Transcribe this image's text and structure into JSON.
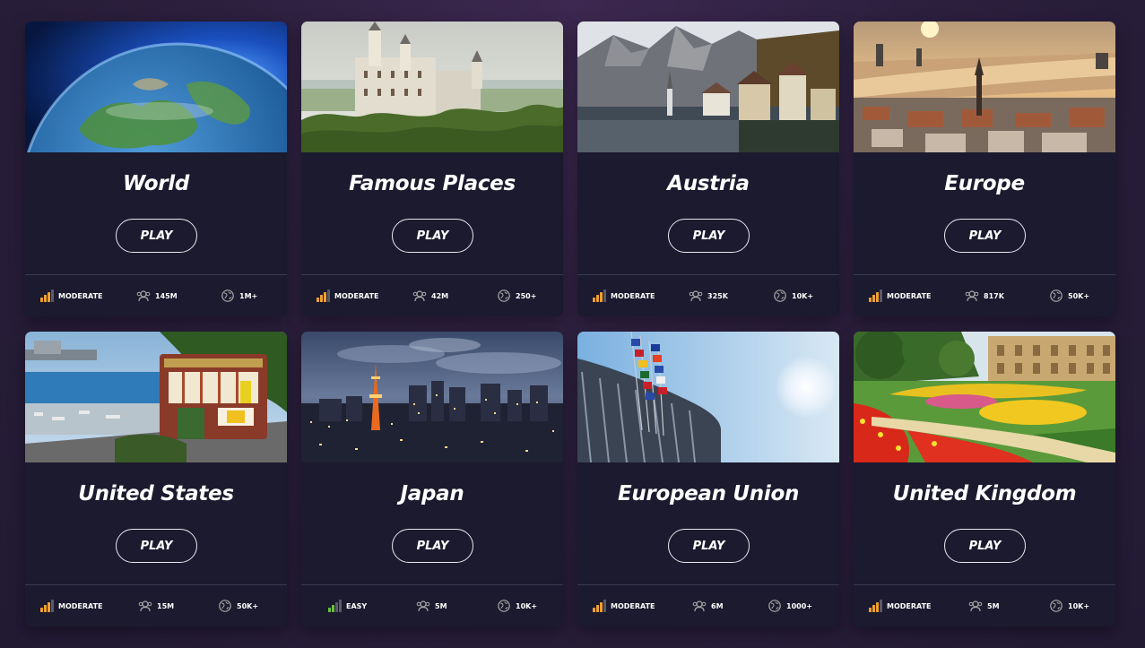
{
  "cards": [
    {
      "title": "World",
      "play_label": "PLAY",
      "difficulty": "MODERATE",
      "difficulty_level": 2,
      "players": "145M",
      "locations": "1M+",
      "image": "earth-from-space"
    },
    {
      "title": "Famous Places",
      "play_label": "PLAY",
      "difficulty": "MODERATE",
      "difficulty_level": 2,
      "players": "42M",
      "locations": "250+",
      "image": "neuschwanstein-castle"
    },
    {
      "title": "Austria",
      "play_label": "PLAY",
      "difficulty": "MODERATE",
      "difficulty_level": 2,
      "players": "325K",
      "locations": "10K+",
      "image": "hallstatt-lake-village"
    },
    {
      "title": "Europe",
      "play_label": "PLAY",
      "difficulty": "MODERATE",
      "difficulty_level": 2,
      "players": "817K",
      "locations": "50K+",
      "image": "riga-river-sunset"
    },
    {
      "title": "United States",
      "play_label": "PLAY",
      "difficulty": "MODERATE",
      "difficulty_level": 2,
      "players": "15M",
      "locations": "50K+",
      "image": "san-francisco-cable-car"
    },
    {
      "title": "Japan",
      "play_label": "PLAY",
      "difficulty": "EASY",
      "difficulty_level": 1,
      "players": "5M",
      "locations": "10K+",
      "image": "tokyo-night-skyline"
    },
    {
      "title": "European Union",
      "play_label": "PLAY",
      "difficulty": "MODERATE",
      "difficulty_level": 2,
      "players": "6M",
      "locations": "1000+",
      "image": "eu-parliament-flags"
    },
    {
      "title": "United Kingdom",
      "play_label": "PLAY",
      "difficulty": "MODERATE",
      "difficulty_level": 2,
      "players": "5M",
      "locations": "10K+",
      "image": "english-garden-manor"
    }
  ],
  "colors": {
    "background": "#2b1f3d",
    "card": "#1b1a2e",
    "moderate": "#f0a030",
    "easy": "#6bbf3a",
    "bar_inactive": "#5a5a6a"
  }
}
